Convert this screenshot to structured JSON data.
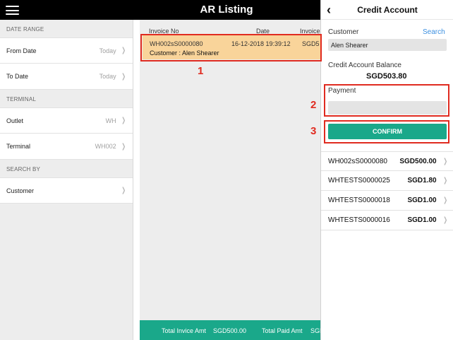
{
  "header": {
    "title": "AR Listing",
    "menu_icon": "hamburger-icon"
  },
  "filters": {
    "date_range": {
      "header": "DATE RANGE",
      "from": {
        "label": "From Date",
        "value": "Today"
      },
      "to": {
        "label": "To Date",
        "value": "Today"
      }
    },
    "terminal": {
      "header": "TERMINAL",
      "outlet": {
        "label": "Outlet",
        "value": "WH"
      },
      "terminal": {
        "label": "Terminal",
        "value": "WH002"
      }
    },
    "search_by": {
      "header": "SEARCH BY",
      "customer": {
        "label": "Customer",
        "value": ""
      }
    }
  },
  "listing": {
    "columns": [
      "Invoice No",
      "Date",
      "Invoice"
    ],
    "rows": [
      {
        "invoice_no": "WH002sS0000080",
        "date": "16-12-2018 19:39:12",
        "amount": "SGD5",
        "customer": "Customer : Alen Shearer"
      }
    ],
    "totals": {
      "invoice_label": "Total Invice Amt",
      "invoice_value": "SGD500.00",
      "paid_label": "Total Paid Amt",
      "paid_value": "SGD"
    }
  },
  "credit_account": {
    "title": "Credit Account",
    "customer_label": "Customer",
    "search_label": "Search",
    "customer_value": "Alen Shearer",
    "balance_label": "Credit Account Balance",
    "balance_value": "SGD503.80",
    "payment_label": "Payment",
    "payment_value": "",
    "confirm_label": "CONFIRM",
    "payments": [
      {
        "invoice": "WH002sS0000080",
        "amount": "SGD500.00"
      },
      {
        "invoice": "WHTESTS0000025",
        "amount": "SGD1.80"
      },
      {
        "invoice": "WHTESTS0000018",
        "amount": "SGD1.00"
      },
      {
        "invoice": "WHTESTS0000016",
        "amount": "SGD1.00"
      }
    ]
  },
  "annotations": [
    "1",
    "2",
    "3"
  ],
  "colors": {
    "accent": "#1aa88a",
    "highlight_row": "#f9d49a",
    "annotation": "#e02b20",
    "link": "#3b8fe0"
  }
}
